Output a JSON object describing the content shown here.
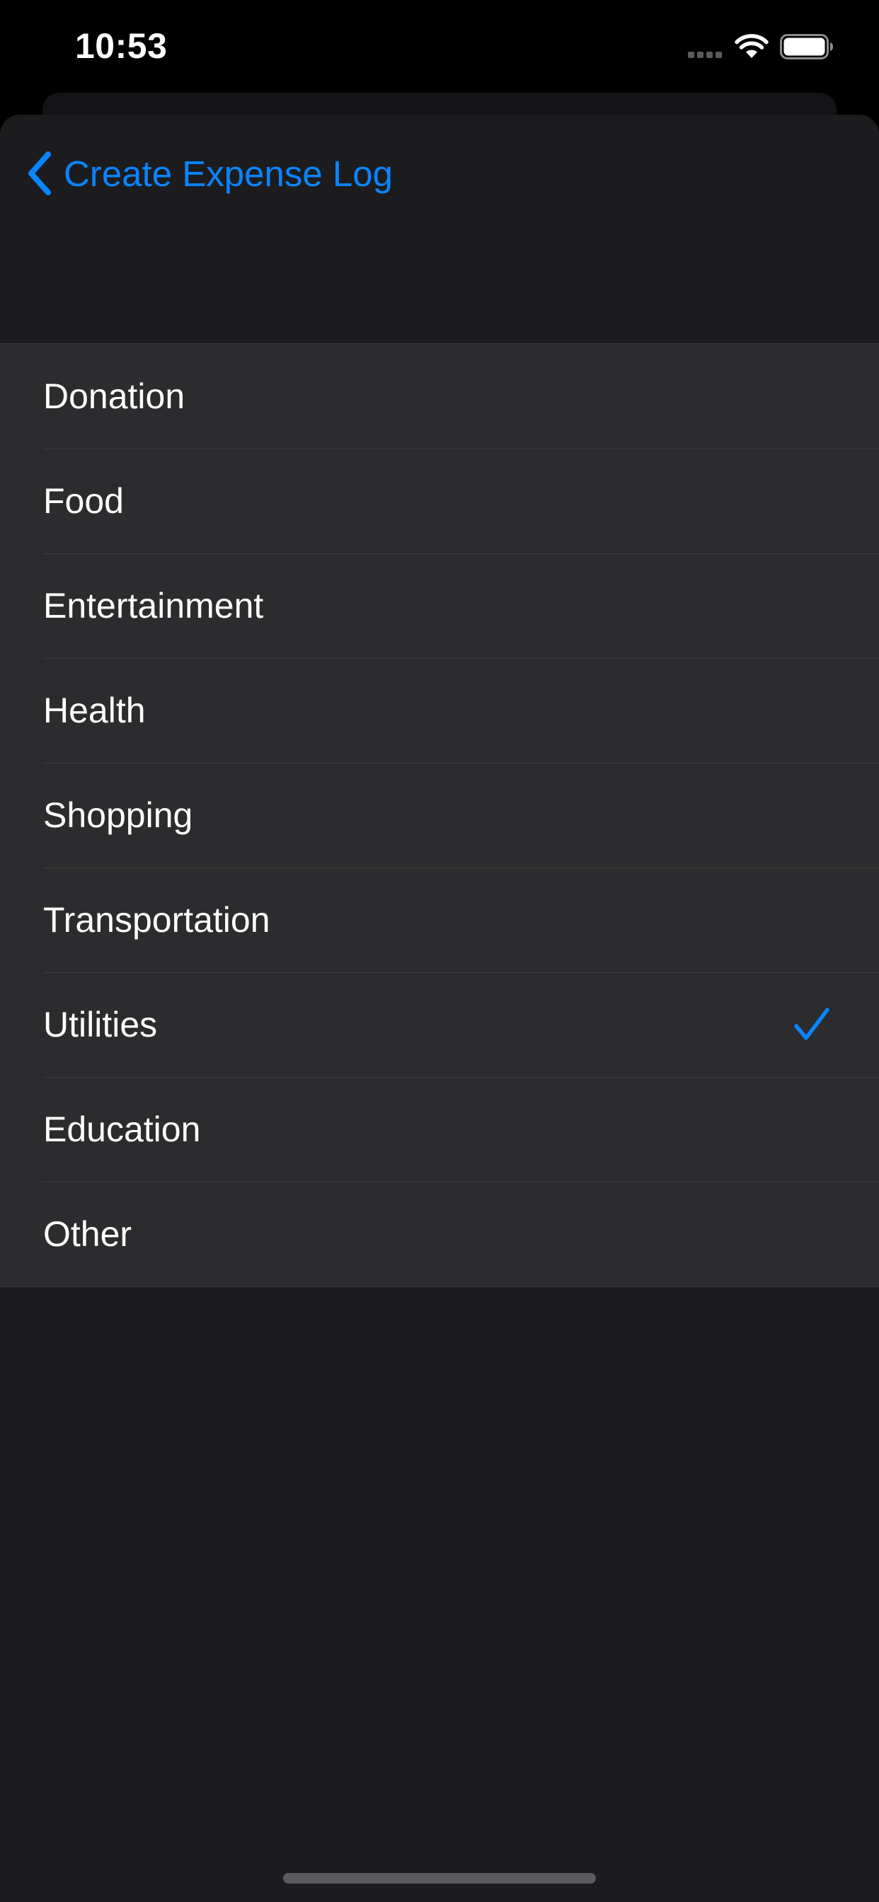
{
  "status_bar": {
    "time": "10:53",
    "icons": [
      "signal-icon",
      "wifi-icon",
      "battery-icon"
    ]
  },
  "nav": {
    "back_label": "Create Expense Log",
    "back_icon": "chevron-left-icon"
  },
  "categories": {
    "items": [
      {
        "label": "Donation",
        "selected": false
      },
      {
        "label": "Food",
        "selected": false
      },
      {
        "label": "Entertainment",
        "selected": false
      },
      {
        "label": "Health",
        "selected": false
      },
      {
        "label": "Shopping",
        "selected": false
      },
      {
        "label": "Transportation",
        "selected": false
      },
      {
        "label": "Utilities",
        "selected": true
      },
      {
        "label": "Education",
        "selected": false
      },
      {
        "label": "Other",
        "selected": false
      }
    ]
  },
  "colors": {
    "accent": "#0a84ff",
    "background": "#1c1c1e",
    "cell": "#2c2c2e",
    "separator": "#3d3d40"
  }
}
